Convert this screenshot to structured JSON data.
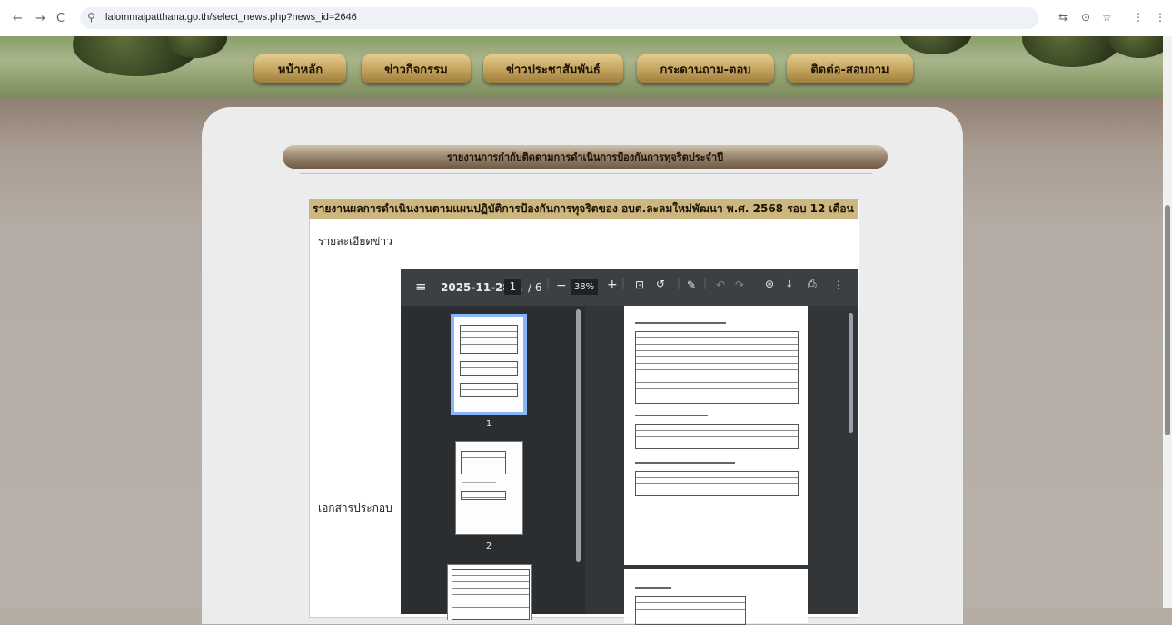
{
  "browser": {
    "back_icon": "arrow-left",
    "forward_icon": "arrow-right",
    "reload_icon": "reload",
    "url": "lalommaipatthana.go.th/select_news.php?news_id=2646"
  },
  "nav": {
    "items": [
      "หน้าหลัก",
      "ข่าวกิจกรรม",
      "ข่าวประชาสัมพันธ์",
      "กระดานถาม-ตอบ",
      "ติดต่อ-สอบถาม"
    ]
  },
  "section": {
    "title": "รายงานการกำกับติดตามการดำเนินการป้องกันการทุจริตประจำปี"
  },
  "news": {
    "title": "รายงานผลการดำเนินงานตามแผนปฏิบัติการป้องกันการทุจริตของ อบต.ละลมใหม่พัฒนา พ.ศ. 2568 รอบ 12 เดือน",
    "detail_label": "รายละเอียดข่าว",
    "attachment_label": "เอกสารประกอบ"
  },
  "pdf": {
    "filename": "2025-11-28...",
    "page_current": "1",
    "page_total": "/ 6",
    "zoom": "38%",
    "thumbnail_numbers": [
      "1",
      "2"
    ]
  }
}
